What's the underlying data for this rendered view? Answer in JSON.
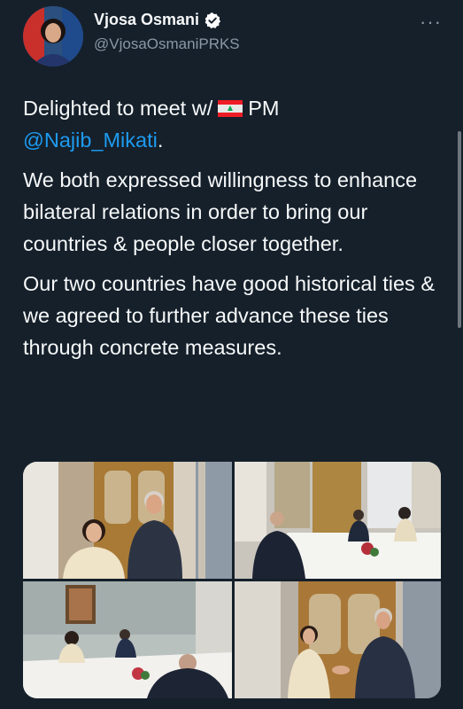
{
  "author": {
    "name": "Vjosa Osmani",
    "handle": "@VjosaOsmaniPRKS",
    "verified": true,
    "avatar_icon": "profile-avatar"
  },
  "menu": {
    "more_label": "···"
  },
  "tweet": {
    "line1_prefix": "Delighted to meet w/",
    "flag_icon": "lebanon-flag-emoji",
    "line1_suffix": "PM",
    "mention": "@Najib_Mikati",
    "mention_suffix": ".",
    "paragraph2": "We both expressed willingness to enhance bilateral relations in order to bring our countries & people closer together.",
    "paragraph3": "Our two countries have good historical ties & we agreed to further advance these ties through concrete measures."
  },
  "media": {
    "photos": [
      {
        "icon": "photo-two-leaders-standing"
      },
      {
        "icon": "photo-meeting-table"
      },
      {
        "icon": "photo-meeting-table-wide"
      },
      {
        "icon": "photo-handshake"
      }
    ]
  },
  "colors": {
    "background": "#15202b",
    "text": "#f7f9f9",
    "secondary": "#8b98a5",
    "accent": "#1d9bf0"
  }
}
